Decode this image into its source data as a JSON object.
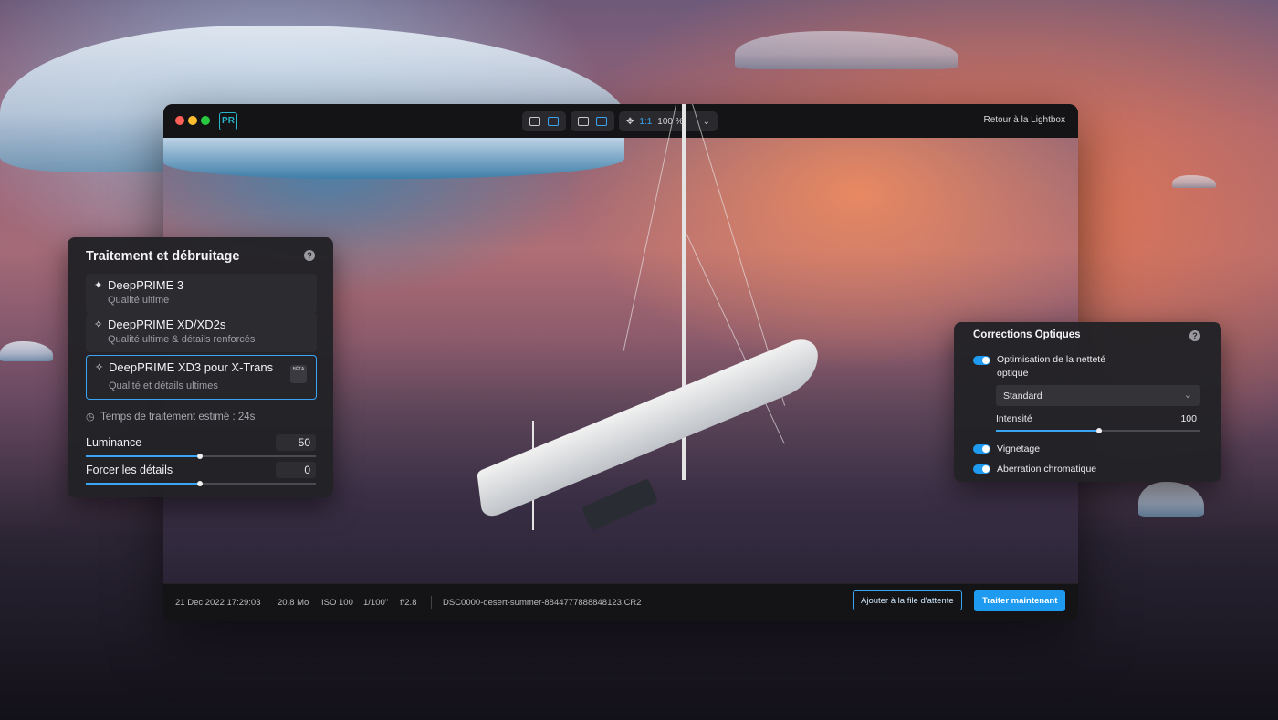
{
  "window": {
    "logo": "PR",
    "toolbar": {
      "zoom_1to1": "1:1",
      "zoom_percent": "100 %"
    },
    "back_link": "Retour à la Lightbox"
  },
  "status": {
    "date": "21 Dec 2022 17:29:03",
    "size": "20.8 Mo",
    "iso": "ISO 100",
    "shutter": "1/100\"",
    "aperture": "f/2.8",
    "filename": "DSC0000-desert-summer-8844777888848123.CR2",
    "queue_button": "Ajouter à la file d'attente",
    "process_button": "Traiter maintenant"
  },
  "denoise": {
    "title": "Traitement et débruitage",
    "options": [
      {
        "title": "DeepPRIME 3",
        "subtitle": "Qualité ultime"
      },
      {
        "title": "DeepPRIME XD/XD2s",
        "subtitle": "Qualité ultime & détails renforcés"
      },
      {
        "title": "DeepPRIME XD3 pour X-Trans",
        "subtitle": "Qualité et détails ultimes",
        "badge": "BÊTA"
      }
    ],
    "estimate": "Temps de traitement estimé : 24s",
    "sliders": [
      {
        "label": "Luminance",
        "value": "50",
        "fraction": 0.5
      },
      {
        "label": "Forcer les détails",
        "value": "0",
        "fraction": 0.5
      }
    ]
  },
  "optics": {
    "title": "Corrections Optiques",
    "sharpness_label_1": "Optimisation de la netteté",
    "sharpness_label_2": "optique",
    "sharpness_on": true,
    "mode": "Standard",
    "intensity_label": "Intensité",
    "intensity_value": "100",
    "intensity_fraction": 0.5,
    "vignetting_label": "Vignetage",
    "vignetting_on": true,
    "chromatic_label": "Aberration chromatique",
    "chromatic_on": true
  },
  "colors": {
    "accent": "#1e9af0",
    "panel": "#222226",
    "logo": "#2bb3c8"
  }
}
